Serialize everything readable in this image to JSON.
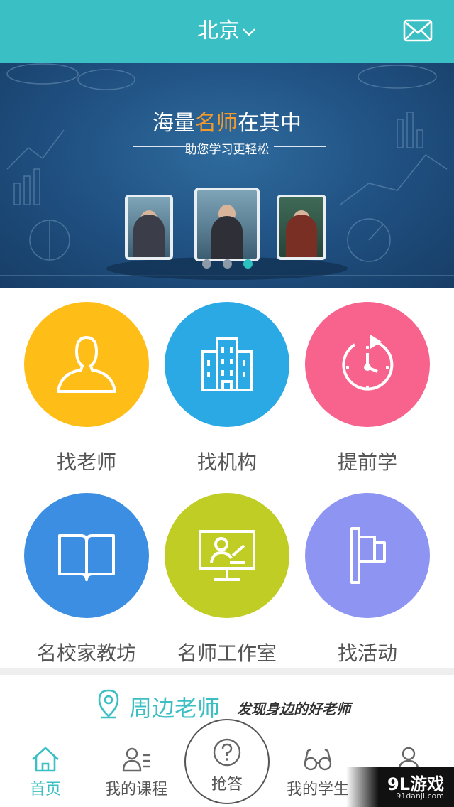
{
  "header": {
    "city": "北京",
    "city_icon": "chevron-down-icon",
    "mail_icon": "mail-icon",
    "color": "#39bfc4"
  },
  "banner": {
    "title_prefix": "海量",
    "title_highlight": "名师",
    "title_suffix": "在其中",
    "subtitle": "助您学习更轻松",
    "slides": 3,
    "active_slide": 3
  },
  "grid": [
    {
      "label": "找老师",
      "icon": "person-icon",
      "color": "#ffbe17"
    },
    {
      "label": "找机构",
      "icon": "building-icon",
      "color": "#2aa9e5"
    },
    {
      "label": "提前学",
      "icon": "stopwatch-icon",
      "color": "#f8638e"
    },
    {
      "label": "名校家教坊",
      "icon": "book-icon",
      "color": "#3c8ee3"
    },
    {
      "label": "名师工作室",
      "icon": "teacher-screen-icon",
      "color": "#bfcd24"
    },
    {
      "label": "找活动",
      "icon": "flag-icon",
      "color": "#8e94f2"
    }
  ],
  "nearby": {
    "title": "周边老师",
    "description": "发现身边的好老师",
    "icon": "location-pin-icon"
  },
  "tabbar": {
    "items": [
      {
        "label": "首页",
        "icon": "home-icon",
        "active": true
      },
      {
        "label": "我的课程",
        "icon": "course-list-icon",
        "active": false
      },
      {
        "label": "我的学生",
        "icon": "glasses-icon",
        "active": false
      },
      {
        "label": "",
        "icon": "user-icon",
        "active": false
      }
    ],
    "center": {
      "label": "抢答",
      "icon": "question-icon"
    }
  },
  "watermark": {
    "main": "9L游戏",
    "sub": "91danji.com"
  }
}
